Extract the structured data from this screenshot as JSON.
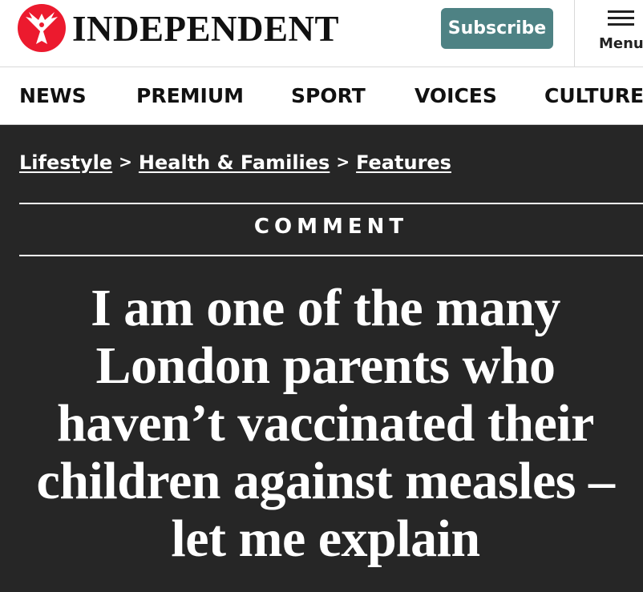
{
  "header": {
    "logo_text": "INDEPENDENT",
    "logo_icon": "eagle-icon",
    "subscribe_label": "Subscribe",
    "menu_label": "Menu",
    "menu_icon": "hamburger-icon"
  },
  "nav": {
    "items": [
      {
        "label": "NEWS"
      },
      {
        "label": "PREMIUM"
      },
      {
        "label": "SPORT"
      },
      {
        "label": "VOICES"
      },
      {
        "label": "CULTURE"
      }
    ]
  },
  "breadcrumb": {
    "items": [
      {
        "label": "Lifestyle"
      },
      {
        "label": "Health & Families"
      },
      {
        "label": "Features"
      }
    ],
    "separator": ">"
  },
  "article": {
    "section": "COMMENT",
    "headline": "I am one of the many London parents who haven’t vaccinated their children against measles – let me explain"
  },
  "colors": {
    "brand_red": "#ec1a2e",
    "subscribe_bg": "#4e8284",
    "article_bg": "#262626"
  }
}
